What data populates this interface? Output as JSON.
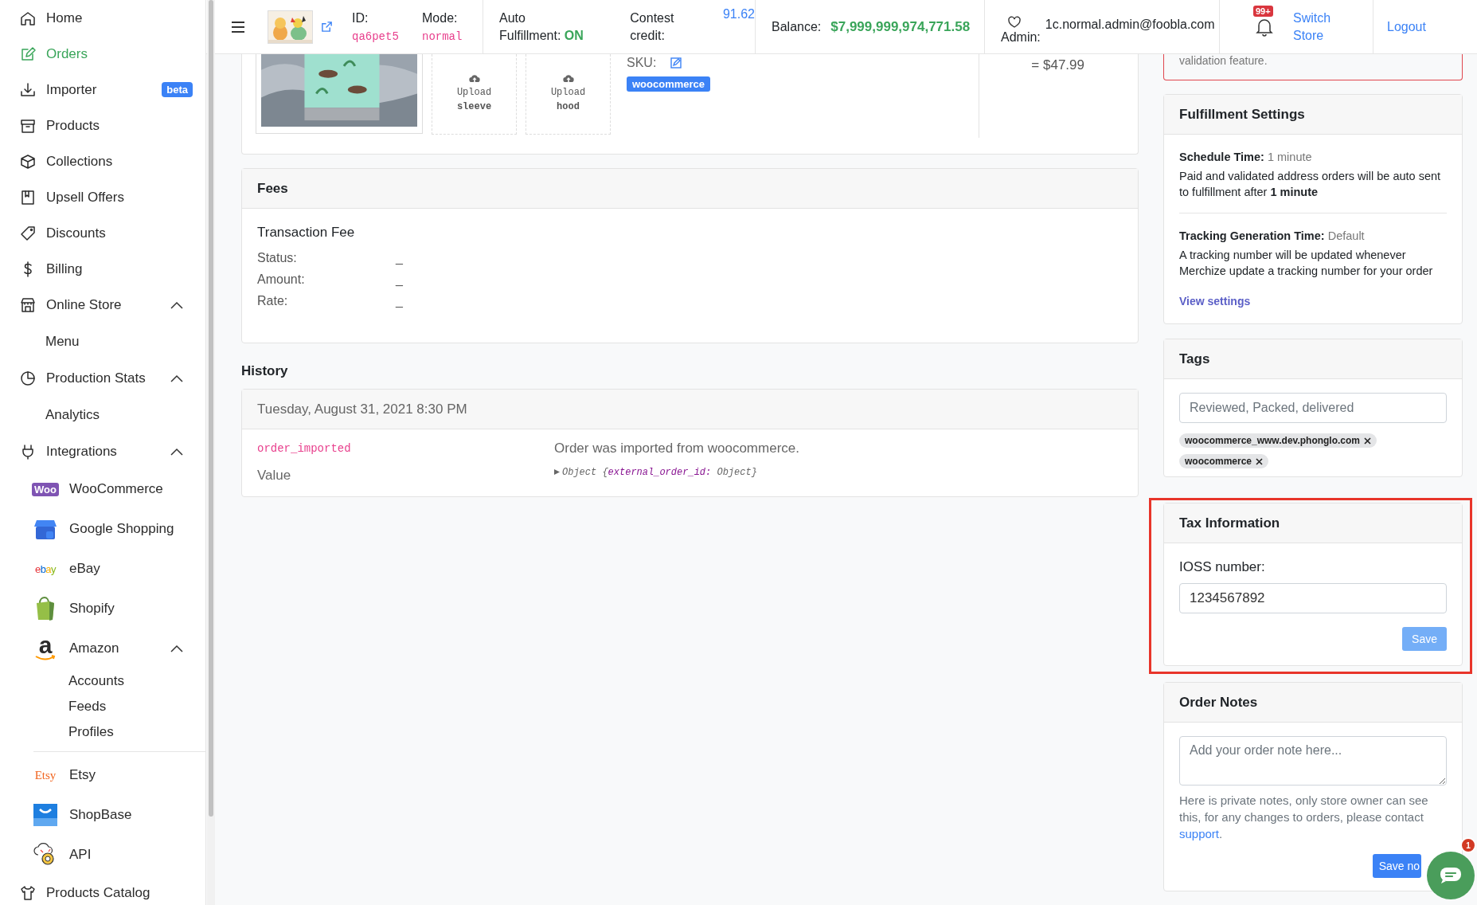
{
  "sidebar": {
    "items": [
      {
        "label": "Home",
        "selected": false
      },
      {
        "label": "Orders",
        "selected": true
      },
      {
        "label": "Importer",
        "selected": false,
        "badge": "beta"
      },
      {
        "label": "Products",
        "selected": false
      },
      {
        "label": "Collections",
        "selected": false
      },
      {
        "label": "Upsell Offers",
        "selected": false
      },
      {
        "label": "Discounts",
        "selected": false
      },
      {
        "label": "Billing",
        "selected": false
      },
      {
        "label": "Online Store",
        "selected": false,
        "expanded": true,
        "children": [
          {
            "label": "Menu",
            "selected": false
          }
        ]
      },
      {
        "label": "Production Stats",
        "selected": false,
        "expanded": true,
        "children": [
          {
            "label": "Analytics",
            "selected": false
          }
        ]
      },
      {
        "label": "Integrations",
        "selected": false,
        "expanded": true,
        "children": [
          {
            "label": "WooCommerce",
            "selected": false,
            "logo": "Woo"
          },
          {
            "label": "Google Shopping",
            "selected": false
          },
          {
            "label": "eBay",
            "selected": false,
            "logo": "ebay"
          },
          {
            "label": "Shopify",
            "selected": false
          },
          {
            "label": "Amazon",
            "selected": false,
            "logo": "a",
            "expanded": true,
            "children": [
              {
                "label": "Accounts",
                "selected": false
              },
              {
                "label": "Feeds",
                "selected": false
              },
              {
                "label": "Profiles",
                "selected": false
              }
            ]
          },
          {
            "label": "Etsy",
            "selected": false,
            "logo": "Etsy"
          },
          {
            "label": "ShopBase",
            "selected": false
          },
          {
            "label": "API",
            "selected": false
          }
        ]
      },
      {
        "label": "Products Catalog",
        "selected": false
      }
    ]
  },
  "header": {
    "id_label": "ID:",
    "id": "qa6pet5",
    "mode_label": "Mode:",
    "mode": "normal",
    "fulfillment": "Auto Fulfillment: **ON**",
    "contest_label": "Contest credit:",
    "contest_value": "91.62",
    "balance_label": "Balance:",
    "balance": "$7,999,999,974,771.58",
    "admin_label": "Admin:",
    "email": "1c.normal.admin@foobla.com",
    "notifications": "99+",
    "switch_store": "Switch Store",
    "logout": "Logout"
  },
  "order_item": {
    "sku_label": "SKU:",
    "uploads": [
      {
        "label": "Upload",
        "part": "sleeve"
      },
      {
        "label": "Upload",
        "part": "hood"
      }
    ],
    "tag": "woocommerce",
    "price": "= $47.99"
  },
  "fees": {
    "title": "Fees",
    "subtitle": "Transaction Fee",
    "rows": [
      {
        "label": "Status:",
        "value": "_"
      },
      {
        "label": "Amount:",
        "value": "_"
      },
      {
        "label": "Rate:",
        "value": "_"
      }
    ]
  },
  "history": {
    "title": "History",
    "entries": [
      {
        "date": "Tuesday, August 31, 2021 8:30 PM",
        "event": "order_imported",
        "message": "Order was imported from woocommerce.",
        "value_label": "Value",
        "value": "Object {**external_order_id:** Object}"
      }
    ]
  },
  "notice": {
    "text": "validation feature."
  },
  "fulfillment": {
    "title": "Fulfillment Settings",
    "sections": [
      {
        "label": "Schedule Time:",
        "value": "1 minute",
        "text": "Paid and validated address orders will be auto sent to fulfillment after **1 minute**"
      },
      {
        "label": "Tracking Generation Time:",
        "value": "Default",
        "text": "A tracking number will be updated whenever Merchize update a tracking number for your order"
      }
    ],
    "link": "View settings"
  },
  "tags": {
    "title": "Tags",
    "placeholder": "Reviewed, Packed, delivered",
    "chips": [
      "woocommerce_www.dev.phonglo.com",
      "woocommerce"
    ]
  },
  "tax": {
    "title": "Tax Information",
    "highlighted": true,
    "label": "IOSS number:",
    "value": "1234567892",
    "button": "Save",
    "button_disabled": true
  },
  "notes": {
    "title": "Order Notes",
    "placeholder": "Add your order note here...",
    "help": "Here is private notes, only store owner can see this, for any changes to orders, please contact",
    "link": "support",
    "after": ".",
    "button": "Save no"
  },
  "chat": {
    "badge": "1"
  }
}
